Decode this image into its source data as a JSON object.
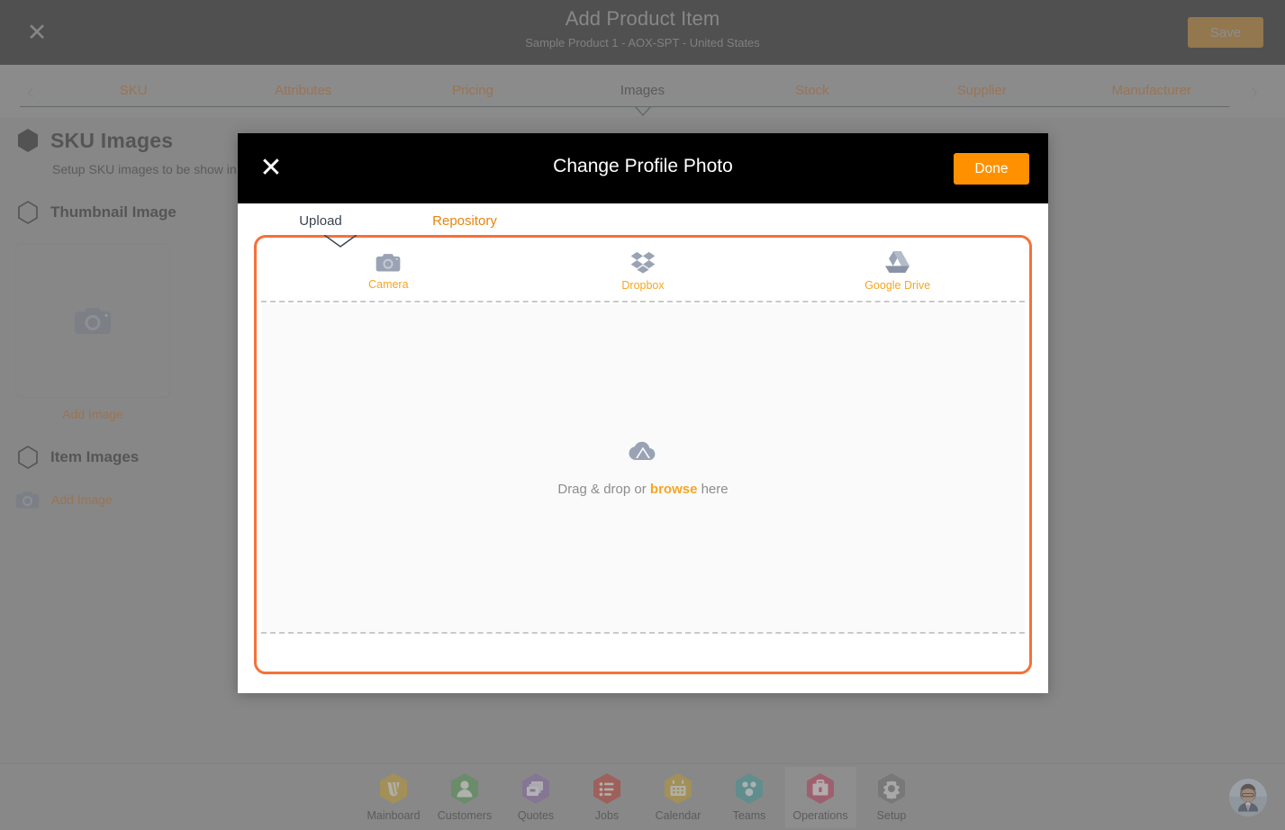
{
  "app_header": {
    "close_icon": "close-icon",
    "title": "Add Product Item",
    "subtitle": "Sample Product 1 - AOX-SPT - United States",
    "save_label": "Save",
    "save_color": "#a96a10"
  },
  "tabs": {
    "prev_icon": "chevron-left-icon",
    "next_icon": "chevron-right-icon",
    "active": "Images",
    "items": [
      {
        "label": "SKU"
      },
      {
        "label": "Attributes"
      },
      {
        "label": "Pricing"
      },
      {
        "label": "Images"
      },
      {
        "label": "Stock"
      },
      {
        "label": "Supplier"
      },
      {
        "label": "Manufacturer"
      }
    ],
    "inactive_color": "#b5651d",
    "active_color": "#2a2a2a"
  },
  "content": {
    "section": {
      "title": "SKU Images",
      "description": "Setup SKU images to be show in C"
    },
    "thumbnail": {
      "title": "Thumbnail Image",
      "placeholder_icon": "camera-icon",
      "add_label": "Add Image"
    },
    "item_images": {
      "title": "Item Images",
      "icon": "camera-icon",
      "add_label": "Add Image"
    }
  },
  "modal": {
    "close_icon": "close-icon",
    "title": "Change Profile Photo",
    "done_label": "Done",
    "done_color": "#FF9100",
    "tabs": [
      {
        "label": "Upload",
        "active": true
      },
      {
        "label": "Repository",
        "active": false
      }
    ],
    "sources": [
      {
        "label": "Camera",
        "icon": "camera-icon"
      },
      {
        "label": "Dropbox",
        "icon": "dropbox-icon"
      },
      {
        "label": "Google Drive",
        "icon": "google-drive-icon"
      }
    ],
    "dropzone": {
      "icon": "cloud-upload-icon",
      "text_before": "Drag & drop or ",
      "browse_label": "browse",
      "text_after": " here"
    },
    "border_color": "#F5703A"
  },
  "bottom_nav": {
    "active": "Operations",
    "items": [
      {
        "label": "Mainboard",
        "icon": "mainboard-icon",
        "color": "#C9A227"
      },
      {
        "label": "Customers",
        "icon": "customers-icon",
        "color": "#4E9A4E"
      },
      {
        "label": "Quotes",
        "icon": "quotes-icon",
        "color": "#8A6CA8"
      },
      {
        "label": "Jobs",
        "icon": "jobs-icon",
        "color": "#C0392B"
      },
      {
        "label": "Calendar",
        "icon": "calendar-icon",
        "color": "#C9A227"
      },
      {
        "label": "Teams",
        "icon": "teams-icon",
        "color": "#3B9C9C"
      },
      {
        "label": "Operations",
        "icon": "operations-icon",
        "color": "#C2395A"
      },
      {
        "label": "Setup",
        "icon": "setup-icon",
        "color": "#6E6E6E"
      }
    ],
    "avatar": "user-avatar"
  }
}
